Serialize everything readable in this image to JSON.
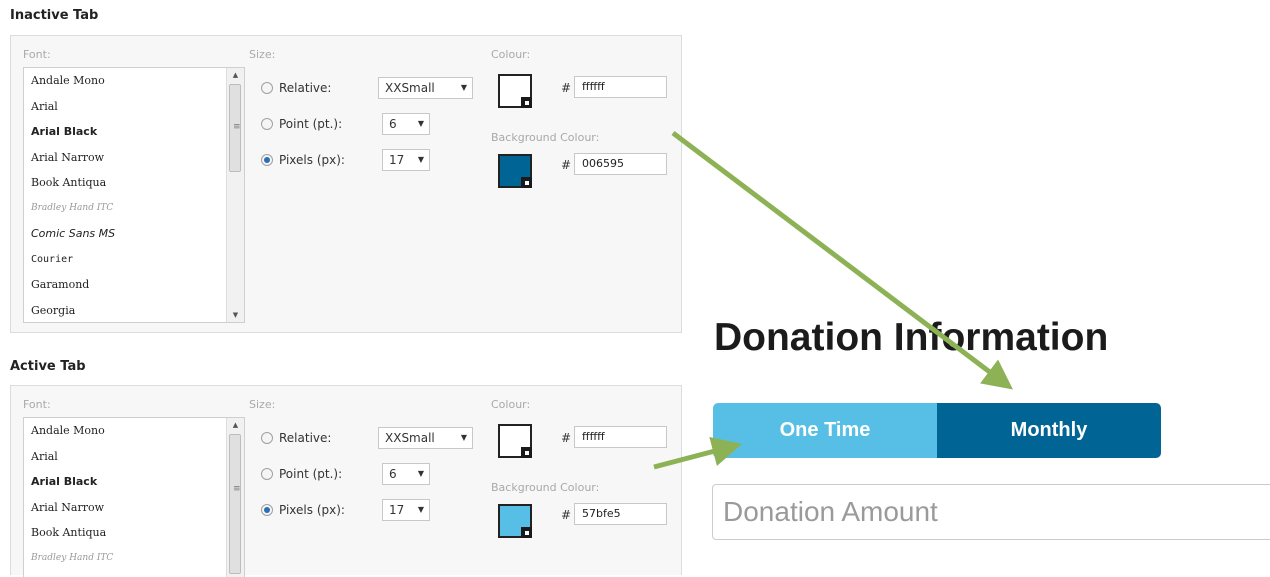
{
  "inactive_tab": {
    "title": "Inactive Tab",
    "font_label": "Font:",
    "fonts": [
      "Andale Mono",
      "Arial",
      "Arial Black",
      "Arial Narrow",
      "Book Antiqua",
      "Bradley Hand ITC",
      "Comic Sans MS",
      "Courier",
      "Garamond",
      "Georgia"
    ],
    "size_label": "Size:",
    "relative_label": "Relative:",
    "relative_value": "XXSmall",
    "point_label": "Point (pt.):",
    "point_value": "6",
    "pixels_label": "Pixels (px):",
    "pixels_value": "17",
    "selected_size_mode": "pixels",
    "colour_label": "Colour:",
    "colour_hash": "#",
    "colour_value": "ffffff",
    "colour_swatch": "#ffffff",
    "background_label": "Background Colour:",
    "background_hash": "#",
    "background_value": "006595",
    "background_swatch": "#006595"
  },
  "active_tab": {
    "title": "Active Tab",
    "font_label": "Font:",
    "fonts": [
      "Andale Mono",
      "Arial",
      "Arial Black",
      "Arial Narrow",
      "Book Antiqua",
      "Bradley Hand ITC"
    ],
    "size_label": "Size:",
    "relative_label": "Relative:",
    "relative_value": "XXSmall",
    "point_label": "Point (pt.):",
    "point_value": "6",
    "pixels_label": "Pixels (px):",
    "pixels_value": "17",
    "selected_size_mode": "pixels",
    "colour_label": "Colour:",
    "colour_hash": "#",
    "colour_value": "ffffff",
    "colour_swatch": "#ffffff",
    "background_label": "Background Colour:",
    "background_hash": "#",
    "background_value": "57bfe5",
    "background_swatch": "#57bfe5"
  },
  "donation": {
    "title": "Donation Information",
    "one_time_label": "One Time",
    "monthly_label": "Monthly",
    "amount_placeholder": "Donation Amount",
    "one_time_color": "#57bfe5",
    "monthly_color": "#006595"
  },
  "annotation_arrow_color": "#8db255"
}
